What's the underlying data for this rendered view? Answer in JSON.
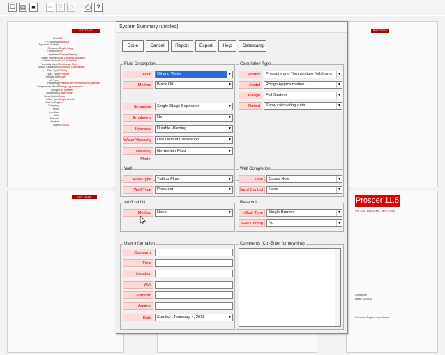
{
  "toolbar": {
    "icons": [
      "new-file-icon",
      "open-folder-icon",
      "save-icon",
      "cut-icon",
      "copy-icon",
      "paste-icon",
      "print-icon",
      "help-icon"
    ],
    "glyphs": [
      "☐",
      "▤",
      "■",
      "✂",
      "⎘",
      "⎙",
      "⎙",
      "?"
    ]
  },
  "background": {
    "pane_options_header": "OPTIONS SUMMARY",
    "pane_pvt_header": "PVT DATA",
    "pane_ipr_header": "IPR DATA",
    "pane_equip_header": "EQUIPMENT DATA",
    "options_list": [
      {
        "k": "Fluid",
        "v": "Oil"
      },
      {
        "k": "PVT Method",
        "v": "Black Oil"
      },
      {
        "k": "Equation Of State",
        "v": ""
      },
      {
        "k": "Separator",
        "v": "Single-Stage"
      },
      {
        "k": "Emulsions",
        "v": "No"
      },
      {
        "k": "Hydrates",
        "v": "Disable Warning"
      },
      {
        "k": "Water Viscosity",
        "v": "Use Default Correlation"
      },
      {
        "k": "Water Vapour",
        "v": "No Calculations"
      },
      {
        "k": "Viscosity Model",
        "v": "Newtonian Fluid"
      },
      {
        "k": "Steam Calculation",
        "v": "No Steam Calculations"
      },
      {
        "k": "Flow Type",
        "v": "Tubing"
      },
      {
        "k": "Well Type",
        "v": "Producer"
      },
      {
        "k": "Artificial Lift",
        "v": "None"
      },
      {
        "k": "Lift Type",
        "v": ""
      },
      {
        "k": "Predicting",
        "v": "Pressure and Temperature (offshore)"
      },
      {
        "k": "Temperature Model",
        "v": "Rough Approximation"
      },
      {
        "k": "Range",
        "v": "Full System"
      },
      {
        "k": "Completion",
        "v": "Cased Hole"
      },
      {
        "k": "Sand Control",
        "v": "None"
      },
      {
        "k": "Inflow Type",
        "v": "Single Branch"
      },
      {
        "k": "Gas Coning",
        "v": "No"
      },
      {
        "k": "Company",
        "v": ""
      },
      {
        "k": "Field",
        "v": ""
      },
      {
        "k": "Location",
        "v": ""
      },
      {
        "k": "Well",
        "v": ""
      },
      {
        "k": "Platform",
        "v": ""
      },
      {
        "k": "Analyst",
        "v": ""
      },
      {
        "k": "Date",
        "v": "02/04/18"
      }
    ],
    "prosper_title": "Prosper 11.5",
    "prosper_sub": "IPM 11.5 - Build # 000 - Jan 27 2018",
    "note_1": "Comments",
    "note_2": "Dated: 02/04/18",
    "note_3": "Petroleum Engineering software"
  },
  "dialog": {
    "title": "System Summary (untitled)",
    "buttons": [
      "Done",
      "Cancel",
      "Report",
      "Export",
      "Help",
      "Datestamp"
    ],
    "fluid_group": {
      "title": "Fluid Description",
      "rows": [
        {
          "label": "Fluid",
          "value": "Oil and Water"
        },
        {
          "label": "Method",
          "value": "Black Oil"
        },
        {
          "label": "Separator",
          "value": "Single-Stage Separator"
        },
        {
          "label": "Emulsions",
          "value": "No"
        },
        {
          "label": "Hydrates",
          "value": "Disable Warning"
        },
        {
          "label": "Water Viscosity",
          "value": "Use Default Correlation"
        },
        {
          "label": "Viscosity Model",
          "value": "Newtonian Fluid"
        }
      ]
    },
    "calc_group": {
      "title": "Calculation Type",
      "rows": [
        {
          "label": "Predict",
          "value": "Pressure and Temperature (offshore)"
        },
        {
          "label": "Model",
          "value": "Rough Approximation"
        },
        {
          "label": "Range",
          "value": "Full System"
        },
        {
          "label": "Output",
          "value": "Show calculating data"
        }
      ]
    },
    "well_group": {
      "title": "Well",
      "rows": [
        {
          "label": "Flow Type",
          "value": "Tubing Flow"
        },
        {
          "label": "Well Type",
          "value": "Producer"
        }
      ]
    },
    "completion_group": {
      "title": "Well Completion",
      "rows": [
        {
          "label": "Type",
          "value": "Cased Hole"
        },
        {
          "label": "Sand Control",
          "value": "None"
        }
      ]
    },
    "lift_group": {
      "title": "Artificial Lift",
      "rows": [
        {
          "label": "Method",
          "value": "None"
        }
      ]
    },
    "reservoir_group": {
      "title": "Reservoir",
      "rows": [
        {
          "label": "Inflow Type",
          "value": "Single Branch"
        },
        {
          "label": "Gas Coning",
          "value": "No"
        }
      ]
    },
    "user_group": {
      "title": "User information",
      "rows": [
        {
          "label": "Company",
          "value": ""
        },
        {
          "label": "Field",
          "value": ""
        },
        {
          "label": "Location",
          "value": ""
        },
        {
          "label": "Well",
          "value": ""
        },
        {
          "label": "Platform",
          "value": ""
        },
        {
          "label": "Analyst",
          "value": ""
        }
      ],
      "date_label": "Date",
      "date_value": "Sunday  ,  February  4, 2018"
    },
    "comments_group": {
      "title": "Comments (Ctrl-Enter for new line)",
      "value": ""
    }
  }
}
